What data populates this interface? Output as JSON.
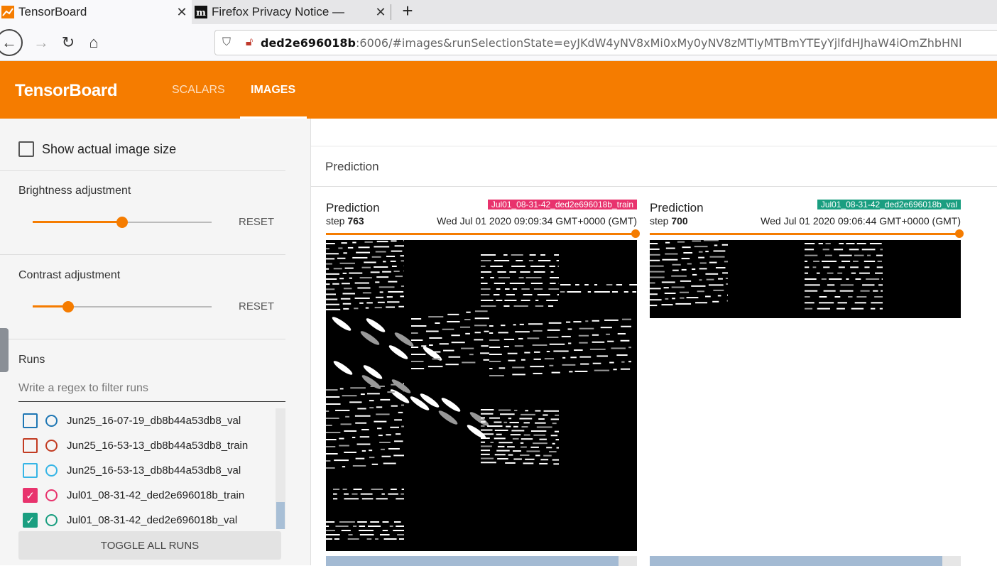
{
  "browser": {
    "tabs": [
      {
        "title": "TensorBoard",
        "icon": "tensorboard-favicon"
      },
      {
        "title": "Firefox Privacy Notice — ",
        "icon": "mozilla-favicon"
      }
    ],
    "new_tab_label": "+",
    "url_host": "ded2e696018b",
    "url_rest": ":6006/#images&runSelectionState=eyJKdW4yNV8xMi0xMy0yNV8zMTIyMTBmYTEyYjlfdHJhaW4iOmZhbHNl"
  },
  "app": {
    "brand": "TensorBoard",
    "nav": [
      "SCALARS",
      "IMAGES"
    ],
    "active_nav": "IMAGES",
    "accent_color": "#f57c00"
  },
  "sidebar": {
    "show_actual_size_label": "Show actual image size",
    "brightness_label": "Brightness adjustment",
    "brightness_value": 0.5,
    "contrast_label": "Contrast adjustment",
    "contrast_value": 0.2,
    "reset_label": "RESET",
    "runs_label": "Runs",
    "filter_placeholder": "Write a regex to filter runs",
    "toggle_label": "TOGGLE ALL RUNS",
    "runs": [
      {
        "name": "Jun25_16-07-19_db8b44a53db8_val",
        "color": "#1f77b4",
        "checked": false
      },
      {
        "name": "Jun25_16-53-13_db8b44a53db8_train",
        "color": "#c23b22",
        "checked": false
      },
      {
        "name": "Jun25_16-53-13_db8b44a53db8_val",
        "color": "#36b5e6",
        "checked": false
      },
      {
        "name": "Jul01_08-31-42_ded2e696018b_train",
        "color": "#e8336d",
        "checked": true
      },
      {
        "name": "Jul01_08-31-42_ded2e696018b_val",
        "color": "#1a9e80",
        "checked": true
      }
    ]
  },
  "main": {
    "card_title": "Prediction",
    "panes": [
      {
        "tag": "Prediction",
        "run": "Jul01_08-31-42_ded2e696018b_train",
        "run_color": "#e8336d",
        "step_label": "step",
        "step": "763",
        "time": "Wed Jul 01 2020 09:09:34 GMT+0000 (GMT)",
        "progress": 0.94
      },
      {
        "tag": "Prediction",
        "run": "Jul01_08-31-42_ded2e696018b_val",
        "run_color": "#1a9e80",
        "step_label": "step",
        "step": "700",
        "time": "Wed Jul 01 2020 09:06:44 GMT+0000 (GMT)",
        "progress": 0.94
      }
    ]
  }
}
